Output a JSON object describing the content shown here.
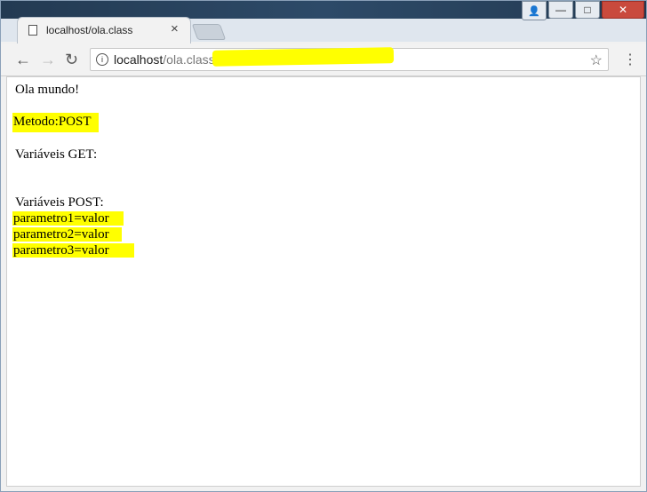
{
  "browser": {
    "tab_title": "localhost/ola.class",
    "url_host": "localhost",
    "url_path": "/ola.class"
  },
  "page": {
    "greeting": "Ola mundo!",
    "method": "Metodo:POST",
    "get_heading": "Variáveis GET:",
    "post_heading": "Variáveis POST:",
    "params": [
      "parametro1=valor",
      "parametro2=valor",
      "parametro3=valor"
    ]
  },
  "colors": {
    "highlight": "#ffff00"
  }
}
